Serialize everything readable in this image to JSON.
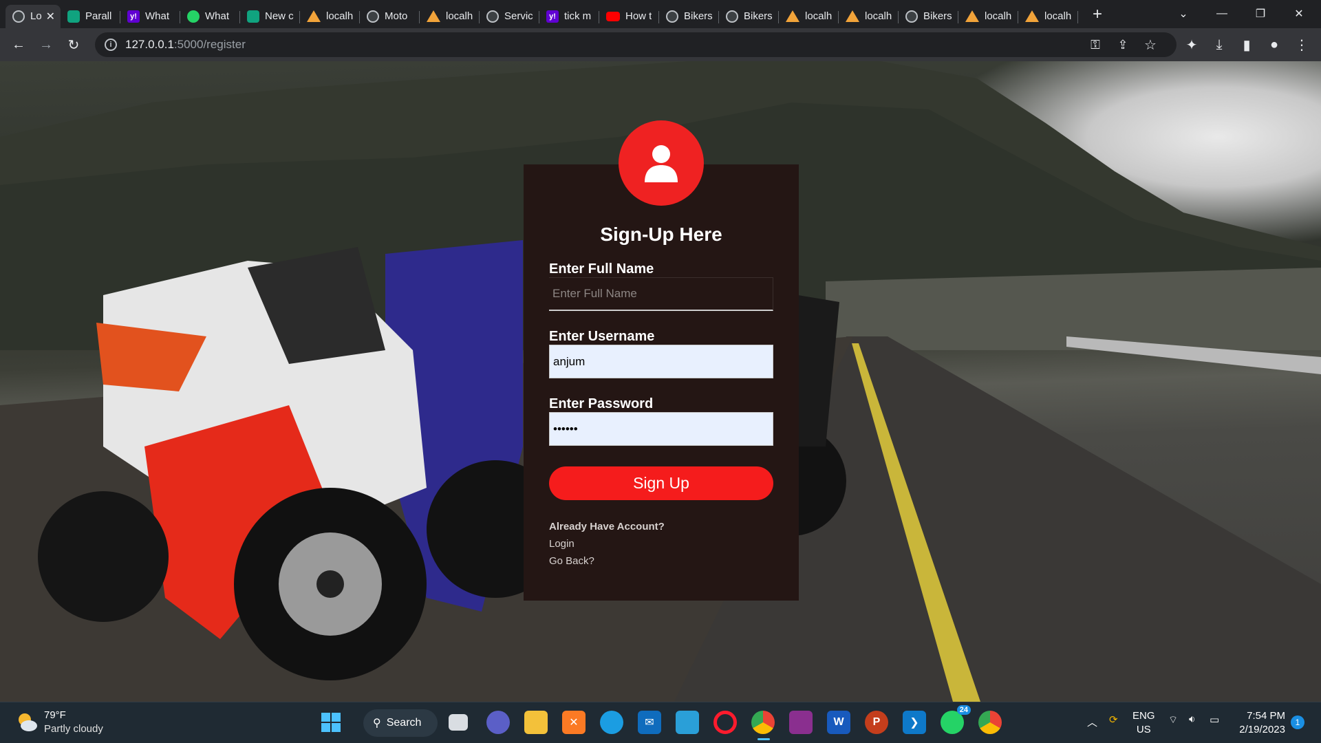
{
  "browser": {
    "tabs": [
      {
        "label": "Lo",
        "icon": "globe-icon",
        "active": true
      },
      {
        "label": "Parall",
        "icon": "chatgpt-icon"
      },
      {
        "label": "What",
        "icon": "yahoo-icon"
      },
      {
        "label": "What",
        "icon": "whatsapp-icon"
      },
      {
        "label": "New c",
        "icon": "chatgpt-icon"
      },
      {
        "label": "localh",
        "icon": "xampp-icon"
      },
      {
        "label": "Moto",
        "icon": "globe-icon"
      },
      {
        "label": "localh",
        "icon": "xampp-icon"
      },
      {
        "label": "Servic",
        "icon": "globe-icon"
      },
      {
        "label": "tick m",
        "icon": "yahoo-icon"
      },
      {
        "label": "How t",
        "icon": "youtube-icon"
      },
      {
        "label": "Bikers",
        "icon": "globe-icon"
      },
      {
        "label": "Bikers",
        "icon": "globe-icon"
      },
      {
        "label": "localh",
        "icon": "xampp-icon"
      },
      {
        "label": "localh",
        "icon": "xampp-icon"
      },
      {
        "label": "Bikers",
        "icon": "globe-icon"
      },
      {
        "label": "localh",
        "icon": "xampp-icon"
      },
      {
        "label": "localh",
        "icon": "xampp-icon"
      }
    ],
    "url_host": "127.0.0.1",
    "url_path": ":5000/register"
  },
  "form": {
    "title": "Sign-Up Here",
    "fullname_label": "Enter Full Name",
    "fullname_placeholder": "Enter Full Name",
    "fullname_value": "",
    "username_label": "Enter Username",
    "username_value": "anjum",
    "password_label": "Enter Password",
    "password_value": "••••••",
    "submit_label": "Sign Up",
    "already_text": "Already Have Account?",
    "login_text": "Login",
    "back_text": "Go Back?"
  },
  "taskbar": {
    "temperature": "79°F",
    "weather": "Partly cloudy",
    "search_label": "Search",
    "whatsapp_badge": "24",
    "language": "ENG",
    "region": "US",
    "time": "7:54 PM",
    "date": "2/19/2023",
    "notification_count": "1"
  },
  "colors": {
    "accent_red": "#f51c1c",
    "card_bg": "#241614",
    "input_autofill": "#e8f0fe"
  }
}
